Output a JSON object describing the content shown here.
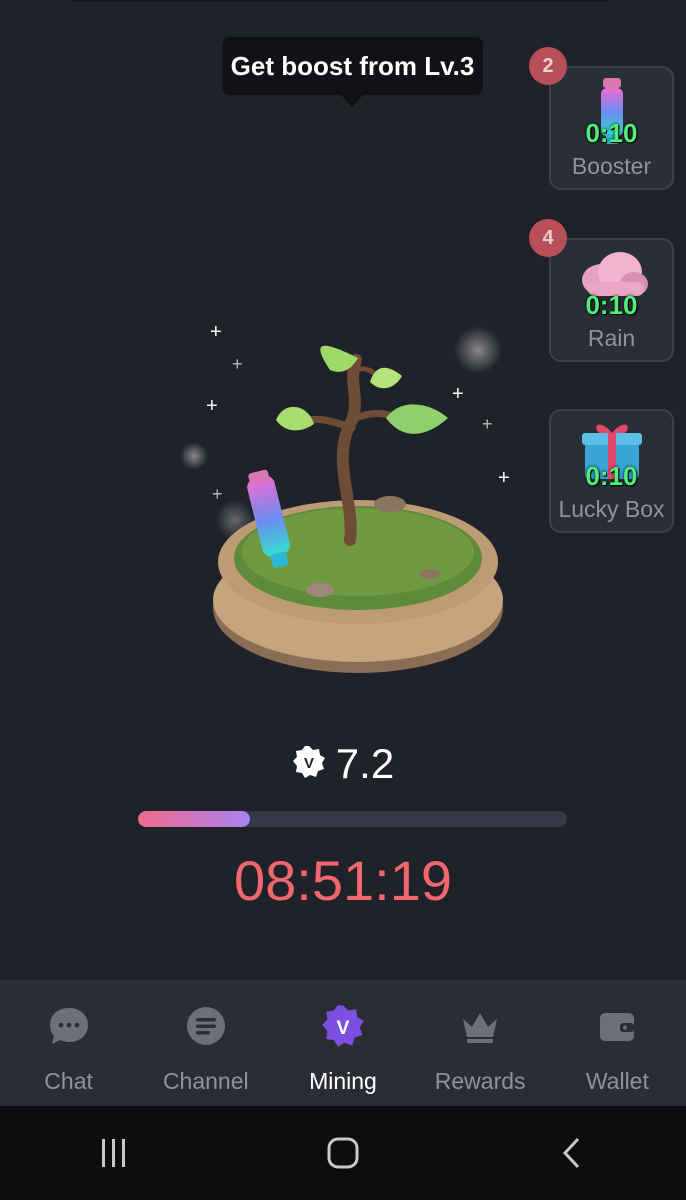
{
  "tooltip": {
    "text": "Get boost from Lv.3"
  },
  "side_cards": [
    {
      "label": "Booster",
      "timer": "0:10",
      "badge": "2",
      "icon": "potion-bottle-icon"
    },
    {
      "label": "Rain",
      "timer": "0:10",
      "badge": "4",
      "icon": "rain-cloud-icon"
    },
    {
      "label": "Lucky Box",
      "timer": "0:10",
      "icon": "gift-box-icon"
    }
  ],
  "mining": {
    "score": "7.2",
    "score_icon": "v-badge-icon",
    "progress_fraction": 0.26,
    "countdown": "08:51:19"
  },
  "bottom_nav": [
    {
      "label": "Chat",
      "icon": "chat-bubble-icon"
    },
    {
      "label": "Channel",
      "icon": "channel-icon"
    },
    {
      "label": "Mining",
      "icon": "mining-v-icon",
      "active": true
    },
    {
      "label": "Rewards",
      "icon": "crown-icon"
    },
    {
      "label": "Wallet",
      "icon": "wallet-icon"
    }
  ],
  "system_nav": [
    "recent-apps-icon",
    "home-icon",
    "back-icon"
  ],
  "colors": {
    "background": "#1f2229",
    "timer_green": "#4ef07a",
    "countdown_red": "#f0676e",
    "progress_start": "#f06b8d",
    "progress_end": "#a983f2",
    "active_accent": "#7b4fe0"
  }
}
